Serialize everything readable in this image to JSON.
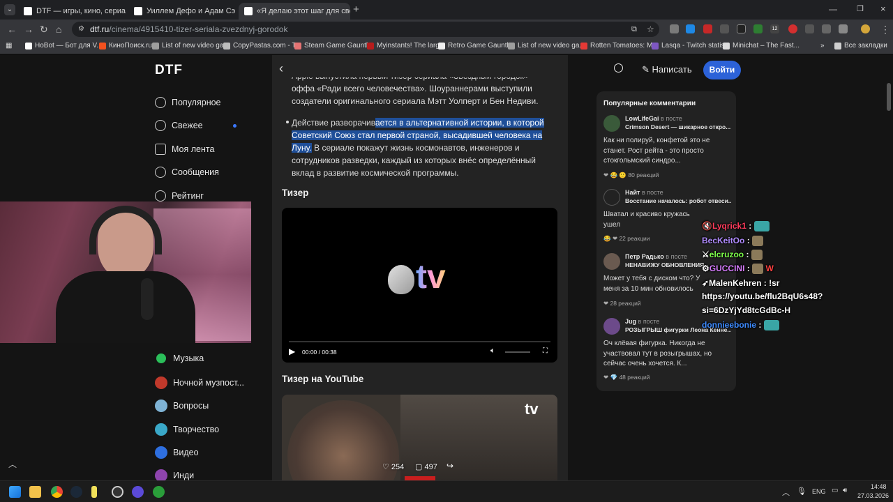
{
  "browser": {
    "tabs": [
      {
        "title": "DTF — игры, кино, сериалы, р",
        "active": false
      },
      {
        "title": "Уиллем Дефо и Адам Сэндлер",
        "active": false
      },
      {
        "title": "«Я делаю этот шаг для своей",
        "active": true
      }
    ],
    "url_host": "dtf.ru",
    "url_path": "/cinema/4915410-tizer-seriala-zvezdnyj-gorodok",
    "bookmarks": [
      "HoBot — Бот для V...",
      "КиноПоиск.ru",
      "List of new video ga...",
      "CopyPastas.com - T...",
      "Steam Game Gauntlet",
      "Myinstants! The larg...",
      "Retro Game Gauntlet",
      "List of new video ga...",
      "Rotten Tomatoes: M...",
      "Lasqa - Twitch statis...",
      "Minichat – The Fast..."
    ],
    "all_bookmarks": "Все закладки",
    "ext_badges": [
      "12"
    ]
  },
  "site": {
    "logo": "DTF",
    "write_label": "Написать",
    "login_label": "Войти",
    "nav": [
      {
        "label": "Популярное",
        "icon": "fire-icon"
      },
      {
        "label": "Свежее",
        "icon": "clock-icon"
      },
      {
        "label": "Моя лента",
        "icon": "list-icon"
      },
      {
        "label": "Сообщения",
        "icon": "chat-icon"
      },
      {
        "label": "Рейтинг",
        "icon": "rating-icon"
      }
    ],
    "nav_bottom": [
      {
        "label": "Музыка",
        "color": "#2bbf5a"
      },
      {
        "label": "Ночной музпост...",
        "color": "#c0392b"
      },
      {
        "label": "Вопросы",
        "color": "#7fb3d5"
      },
      {
        "label": "Творчество",
        "color": "#3aa8c8"
      },
      {
        "label": "Видео",
        "color": "#2e6fe0"
      },
      {
        "label": "Инди",
        "color": "#8e44ad"
      }
    ]
  },
  "article": {
    "para1_line1": "Apple выпустила первый тизер сериала «Звёздный городок» — спин-",
    "para1_line2": "оффа «Ради всего человечества». Шоураннерами выступили",
    "para1_line3": "создатели оригинального сериала Мэтт Уолперт и Бен Недиви.",
    "bullet_plain_a": "Действие разворачив",
    "bullet_hl_1": "ается в альтернативной истории, в которой",
    "bullet_hl_2": "Советский Союз стал первой страной, высадившей человека на",
    "bullet_hl_3": "Луну.",
    "bullet_rest_1": " В сериале покажут жизнь космонавтов, инженеров и",
    "bullet_rest_2": "сотрудников разведки, каждый из которых внёс определённый",
    "bullet_rest_3": "вклад в развитие космической программы.",
    "teaser_heading": "Тизер",
    "video_logo": "tv",
    "video_time": "00:00 / 00:38",
    "yt_heading": "Тизер на YouTube",
    "yt_logo": "tv",
    "likes": "254",
    "comments": "497"
  },
  "sidebar": {
    "title": "Популярные комментарии",
    "comments": [
      {
        "user": "LowLifeGai",
        "in_post": "в посте",
        "post": "Crimson Desert — шикарное откро...",
        "text": "Как ни полируй, конфетой это не станет. Рост рейта - это просто стокгольмский синдро...",
        "reactions": "80 реакций"
      },
      {
        "user": "Найт",
        "in_post": "в посте",
        "post": "Восстание началось: робот отвеси...",
        "text": "Шватал и красиво кружась ушел",
        "reactions": "22 реакции"
      },
      {
        "user": "Петр Радько",
        "in_post": "в посте",
        "post": "НЕНАВИЖУ ОБНОВЛЕНИЯ",
        "text": "Может у тебя с диском что? У меня за 10 мин обновилось",
        "reactions": "28 реакций"
      },
      {
        "user": "Jug",
        "in_post": "в посте",
        "post": "РОЗЫГРЫШ фигурки Леона Кенне...",
        "text": "Оч клёвая фигурка. Никогда не участвовал тут в розыгрышах, но сейчас очень хочется. К...",
        "reactions": "48 реакций"
      }
    ]
  },
  "chat_overlay": [
    {
      "user": "Lyqrick1",
      "color": "#ff3b5c",
      "msg": ""
    },
    {
      "user": "BecKeitOo",
      "color": "#b18cff",
      "msg": ""
    },
    {
      "user": "elcruzoo",
      "color": "#7dff4a",
      "msg": ""
    },
    {
      "user": "GUCCINI",
      "color": "#d87cff",
      "msg": "W"
    },
    {
      "user": "MalenKehren",
      "color": "#ffffff",
      "msg": "!sr"
    },
    {
      "user": "",
      "color": "#ffffff",
      "msg": "https://youtu.be/flu2BqU6s48?"
    },
    {
      "user": "",
      "color": "#ffffff",
      "msg": "si=6DzYjYd8tcGdBc-H"
    },
    {
      "user": "donnieebonie",
      "color": "#3d8bff",
      "msg": ""
    }
  ],
  "taskbar": {
    "lang": "ENG",
    "time": "14:48",
    "date": "27.03.2026"
  }
}
